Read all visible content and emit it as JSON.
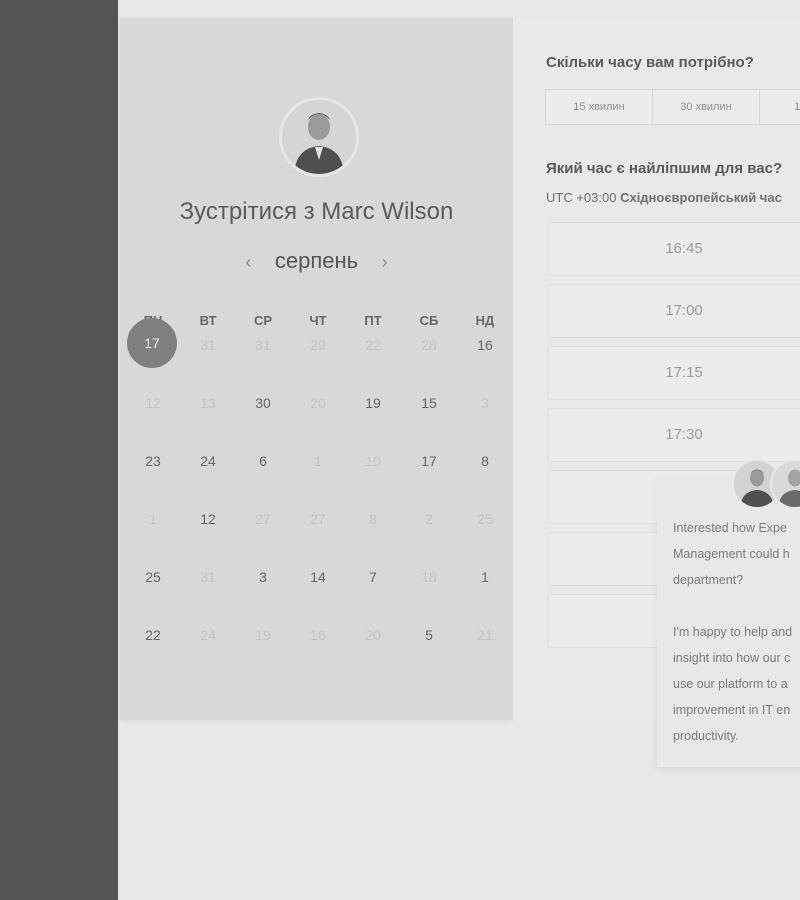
{
  "calendar": {
    "title": "Зустрітися з Marc Wilson",
    "month": "серпень",
    "prev_icon": "‹",
    "next_icon": "›",
    "weekdays": [
      "ПН",
      "ВТ",
      "СР",
      "ЧТ",
      "ПТ",
      "СБ",
      "НД"
    ],
    "selected_day": "17",
    "rows": [
      [
        {
          "t": "17",
          "s": "sel"
        },
        {
          "t": "31",
          "s": "dim"
        },
        {
          "t": "31",
          "s": "dim"
        },
        {
          "t": "29",
          "s": "dim"
        },
        {
          "t": "22",
          "s": "dim"
        },
        {
          "t": "28",
          "s": "dim"
        },
        {
          "t": "16",
          "s": "on"
        }
      ],
      [
        {
          "t": "12",
          "s": "dim"
        },
        {
          "t": "13",
          "s": "dim"
        },
        {
          "t": "30",
          "s": "on"
        },
        {
          "t": "20",
          "s": "dim"
        },
        {
          "t": "19",
          "s": "on"
        },
        {
          "t": "15",
          "s": "on"
        },
        {
          "t": "3",
          "s": "dim"
        }
      ],
      [
        {
          "t": "23",
          "s": "on"
        },
        {
          "t": "24",
          "s": "on"
        },
        {
          "t": "6",
          "s": "on"
        },
        {
          "t": "1",
          "s": "dim"
        },
        {
          "t": "10",
          "s": "dim"
        },
        {
          "t": "17",
          "s": "on"
        },
        {
          "t": "8",
          "s": "on"
        }
      ],
      [
        {
          "t": "1",
          "s": "dim"
        },
        {
          "t": "12",
          "s": "on"
        },
        {
          "t": "27",
          "s": "dim"
        },
        {
          "t": "27",
          "s": "dim"
        },
        {
          "t": "8",
          "s": "dim"
        },
        {
          "t": "2",
          "s": "dim"
        },
        {
          "t": "25",
          "s": "dim"
        }
      ],
      [
        {
          "t": "25",
          "s": "on"
        },
        {
          "t": "31",
          "s": "dim"
        },
        {
          "t": "3",
          "s": "on"
        },
        {
          "t": "14",
          "s": "on"
        },
        {
          "t": "7",
          "s": "on"
        },
        {
          "t": "18",
          "s": "dim"
        },
        {
          "t": "1",
          "s": "on"
        }
      ],
      [
        {
          "t": "22",
          "s": "on"
        },
        {
          "t": "24",
          "s": "dim"
        },
        {
          "t": "19",
          "s": "dim"
        },
        {
          "t": "16",
          "s": "dim"
        },
        {
          "t": "20",
          "s": "dim"
        },
        {
          "t": "5",
          "s": "on"
        },
        {
          "t": "21",
          "s": "dim"
        }
      ]
    ]
  },
  "duration": {
    "question": "Скільки часу вам потрібно?",
    "options": [
      "15 хвилин",
      "30 хвилин",
      "1"
    ]
  },
  "time": {
    "question": "Який час є найліпшим для вас?",
    "tz_offset": "UTC +03:00",
    "tz_name": "Східноєвропейський час",
    "slots": [
      "16:45",
      "17:00",
      "17:15",
      "17:30",
      "",
      "",
      ""
    ]
  },
  "chat": {
    "message": "Interested how Expe\nManagement could h\ndepartment?\n\nI'm happy to help and\ninsight into how our c\nuse our platform to a\nimprovement in IT en\nproductivity."
  },
  "icons": {
    "avatar": "person-avatar",
    "chat_avatars": [
      "person-avatar",
      "person-avatar"
    ]
  }
}
